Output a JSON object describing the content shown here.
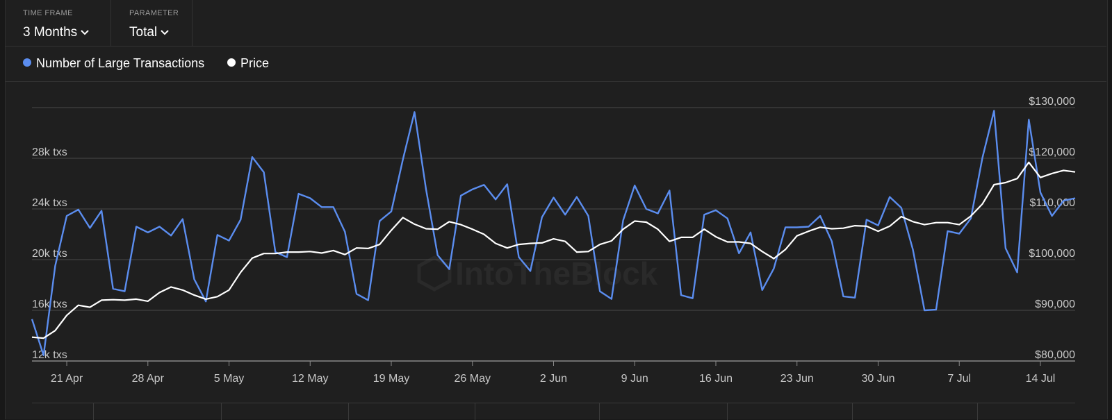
{
  "controls": {
    "time_frame": {
      "label": "TIME FRAME",
      "value": "3 Months"
    },
    "parameter": {
      "label": "PARAMETER",
      "value": "Total"
    }
  },
  "legend": [
    {
      "label": "Number of Large Transactions",
      "color": "#5b8def"
    },
    {
      "label": "Price",
      "color": "#ffffff"
    }
  ],
  "watermark": "IntoTheBlock",
  "colors": {
    "background": "#1f1f1f",
    "grid": "#4a4a4a",
    "transactions_line": "#5b8def",
    "price_line": "#ffffff",
    "tick_text": "#c8c8c8"
  },
  "chart_data": {
    "type": "line",
    "x_tick_labels": [
      "21 Apr",
      "28 Apr",
      "5 May",
      "12 May",
      "19 May",
      "26 May",
      "2 Jun",
      "9 Jun",
      "16 Jun",
      "23 Jun",
      "30 Jun",
      "7 Jul",
      "14 Jul"
    ],
    "x_start": "18 Apr",
    "x_end": "18 Jul",
    "left_axis": {
      "ticks": [
        "12k txs",
        "16k txs",
        "20k txs",
        "24k txs",
        "28k txs"
      ],
      "range": [
        12000,
        32000
      ]
    },
    "right_axis": {
      "ticks": [
        "$80,000",
        "$90,000",
        "$100,000",
        "$110,000",
        "$120,000",
        "$130,000"
      ],
      "range": [
        80000,
        130000
      ]
    },
    "grid": true,
    "legend_position": "top-left",
    "series": [
      {
        "name": "Number of Large Transactions",
        "axis": "left",
        "values": [
          15300,
          12450,
          19500,
          23450,
          23950,
          22500,
          23850,
          17700,
          17500,
          22600,
          22150,
          22600,
          21900,
          23200,
          18450,
          16700,
          21950,
          21500,
          23150,
          28100,
          26900,
          20600,
          20200,
          25200,
          24850,
          24150,
          24150,
          22200,
          17300,
          16800,
          23050,
          23800,
          27900,
          31650,
          25550,
          20350,
          19250,
          25050,
          25550,
          25900,
          24750,
          25950,
          20200,
          19100,
          23350,
          24900,
          23550,
          24950,
          23450,
          17500,
          16900,
          23100,
          25850,
          24000,
          23650,
          25450,
          17200,
          16950,
          23550,
          23900,
          23250,
          20500,
          22150,
          17600,
          19300,
          22550,
          22550,
          22600,
          23450,
          21450,
          17100,
          17000,
          23150,
          22700,
          24950,
          24100,
          20800,
          16000,
          16050,
          22250,
          22050,
          23250,
          28050,
          31750,
          20900,
          19000,
          31050,
          25300,
          23450,
          24650,
          24850
        ]
      },
      {
        "name": "Price",
        "axis": "right",
        "values": [
          84700,
          84500,
          86000,
          89000,
          91000,
          90600,
          92000,
          92100,
          92000,
          92200,
          91800,
          93500,
          94600,
          94000,
          93000,
          92200,
          92700,
          94000,
          97500,
          100300,
          101200,
          101200,
          101500,
          101500,
          101600,
          101300,
          101800,
          101000,
          102300,
          102200,
          103000,
          105800,
          108300,
          107000,
          106100,
          106000,
          107500,
          106900,
          106000,
          105000,
          103200,
          102300,
          103000,
          103200,
          103300,
          104100,
          103600,
          101500,
          101600,
          103000,
          103700,
          106000,
          107600,
          107400,
          106000,
          103600,
          104400,
          104400,
          106000,
          104500,
          103500,
          103500,
          103200,
          101600,
          100200,
          102000,
          104700,
          105600,
          106400,
          106100,
          106200,
          106700,
          106600,
          105600,
          106600,
          108500,
          107500,
          106900,
          107300,
          107300,
          106900,
          108600,
          111000,
          114800,
          115200,
          116000,
          119200,
          116200,
          117000,
          117600,
          117300
        ]
      }
    ]
  }
}
